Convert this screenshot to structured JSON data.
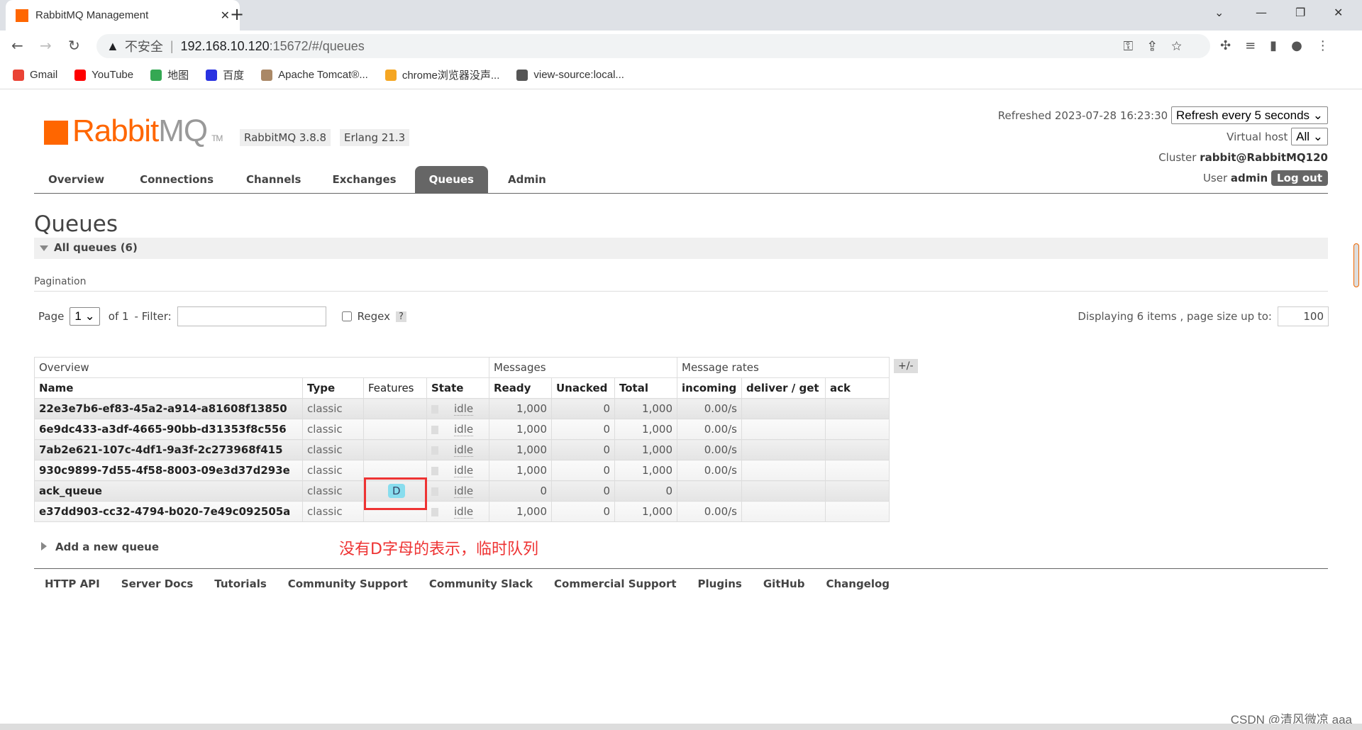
{
  "browser": {
    "tab_title": "RabbitMQ Management",
    "insecure": "不安全",
    "url_host": "192.168.10.120",
    "url_rest": ":15672/#/queues",
    "bookmarks": [
      {
        "label": "Gmail",
        "color": "#ea4335"
      },
      {
        "label": "YouTube",
        "color": "#f00"
      },
      {
        "label": "地图",
        "color": "#34a853"
      },
      {
        "label": "百度",
        "color": "#2932e1"
      },
      {
        "label": "Apache Tomcat®...",
        "color": "#a86"
      },
      {
        "label": "chrome浏览器没声...",
        "color": "#f5a623"
      },
      {
        "label": "view-source:local...",
        "color": "#555"
      }
    ]
  },
  "header": {
    "logo": "RabbitMQ",
    "logo_rabbit": "Rabbit",
    "logo_mq": "MQ",
    "tm": "TM",
    "version": "RabbitMQ 3.8.8",
    "erlang": "Erlang 21.3",
    "refreshed": "Refreshed 2023-07-28 16:23:30",
    "refresh_select": "Refresh every 5 seconds",
    "vhost_label": "Virtual host",
    "vhost_value": "All",
    "cluster_label": "Cluster",
    "cluster": "rabbit@RabbitMQ120",
    "user_label": "User",
    "user": "admin",
    "logout": "Log out"
  },
  "nav": [
    "Overview",
    "Connections",
    "Channels",
    "Exchanges",
    "Queues",
    "Admin"
  ],
  "page": {
    "title": "Queues",
    "section": "All queues (6)",
    "pagination_label": "Pagination",
    "page_label": "Page",
    "page_value": "1",
    "of": "of 1",
    "filter_label": "- Filter:",
    "filter_value": "",
    "regex": "Regex",
    "help": "?",
    "displaying": "Displaying 6 items , page size up to:",
    "page_size": "100"
  },
  "table": {
    "groups": [
      "Overview",
      "Messages",
      "Message rates"
    ],
    "plusminus": "+/-",
    "columns": [
      "Name",
      "Type",
      "Features",
      "State",
      "Ready",
      "Unacked",
      "Total",
      "incoming",
      "deliver / get",
      "ack"
    ],
    "rows": [
      [
        "22e3e7b6-ef83-45a2-a914-a81608f13850",
        "classic",
        "",
        "idle",
        "1,000",
        "0",
        "1,000",
        "0.00/s",
        "",
        ""
      ],
      [
        "6e9dc433-a3df-4665-90bb-d31353f8c556",
        "classic",
        "",
        "idle",
        "1,000",
        "0",
        "1,000",
        "0.00/s",
        "",
        ""
      ],
      [
        "7ab2e621-107c-4df1-9a3f-2c273968f415",
        "classic",
        "",
        "idle",
        "1,000",
        "0",
        "1,000",
        "0.00/s",
        "",
        ""
      ],
      [
        "930c9899-7d55-4f58-8003-09e3d37d293e",
        "classic",
        "",
        "idle",
        "1,000",
        "0",
        "1,000",
        "0.00/s",
        "",
        ""
      ],
      [
        "ack_queue",
        "classic",
        "D",
        "idle",
        "0",
        "0",
        "0",
        "",
        "",
        ""
      ],
      [
        "e37dd903-cc32-4794-b020-7e49c092505a",
        "classic",
        "",
        "idle",
        "1,000",
        "0",
        "1,000",
        "0.00/s",
        "",
        ""
      ]
    ]
  },
  "annotation": "没有D字母的表示，临时队列",
  "add_queue": "Add a new queue",
  "footer": [
    "HTTP API",
    "Server Docs",
    "Tutorials",
    "Community Support",
    "Community Slack",
    "Commercial Support",
    "Plugins",
    "GitHub",
    "Changelog"
  ],
  "watermark": "CSDN @清风微凉 aaa"
}
